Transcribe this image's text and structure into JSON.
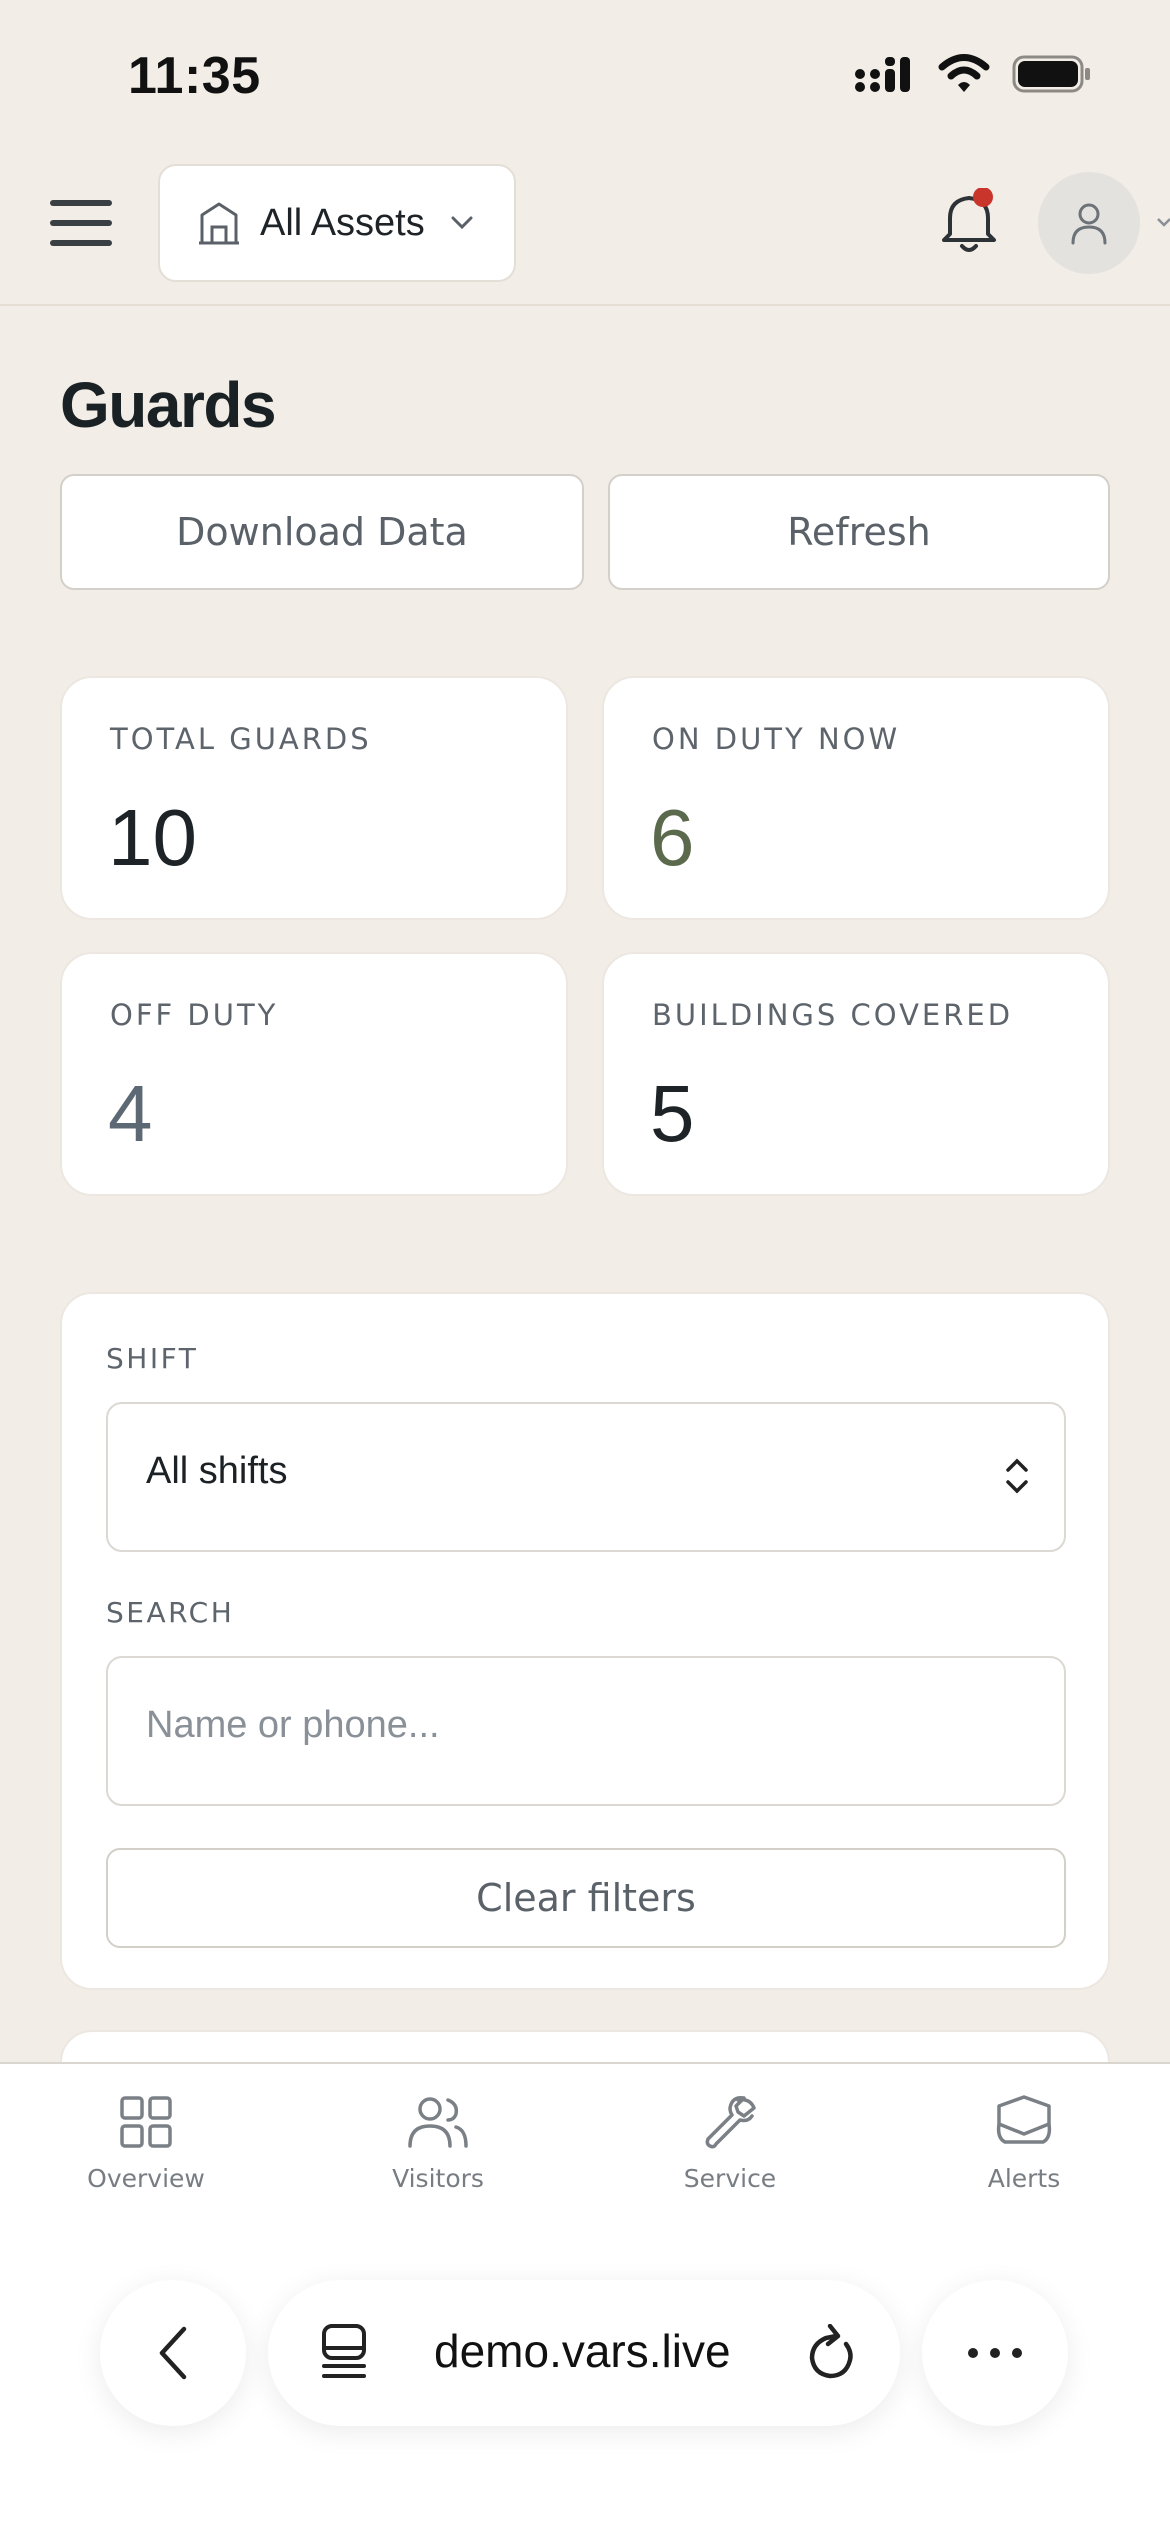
{
  "status_bar": {
    "time": "11:35"
  },
  "header": {
    "asset_selector": "All Assets",
    "has_unread_notifications": true
  },
  "page": {
    "title": "Guards",
    "download_label": "Download Data",
    "refresh_label": "Refresh"
  },
  "stats": [
    {
      "label": "TOTAL GUARDS",
      "value": "10",
      "color": "#1d2326"
    },
    {
      "label": "ON DUTY NOW",
      "value": "6",
      "color": "#5b6a4c"
    },
    {
      "label": "OFF DUTY",
      "value": "4",
      "color": "#5c6873"
    },
    {
      "label": "BUILDINGS COVERED",
      "value": "5",
      "color": "#1d2326"
    }
  ],
  "filters": {
    "shift_label": "SHIFT",
    "shift_value": "All shifts",
    "search_label": "SEARCH",
    "search_placeholder": "Name or phone...",
    "clear_label": "Clear filters"
  },
  "bottom_nav": [
    {
      "label": "Overview",
      "icon": "grid-icon"
    },
    {
      "label": "Visitors",
      "icon": "users-icon"
    },
    {
      "label": "Service",
      "icon": "wrench-icon"
    },
    {
      "label": "Alerts",
      "icon": "shield-icon"
    }
  ],
  "browser": {
    "url": "demo.vars.live"
  },
  "colors": {
    "background": "#f2ede6",
    "alert_dot": "#c9352b",
    "on_duty": "#5b6a4c"
  }
}
